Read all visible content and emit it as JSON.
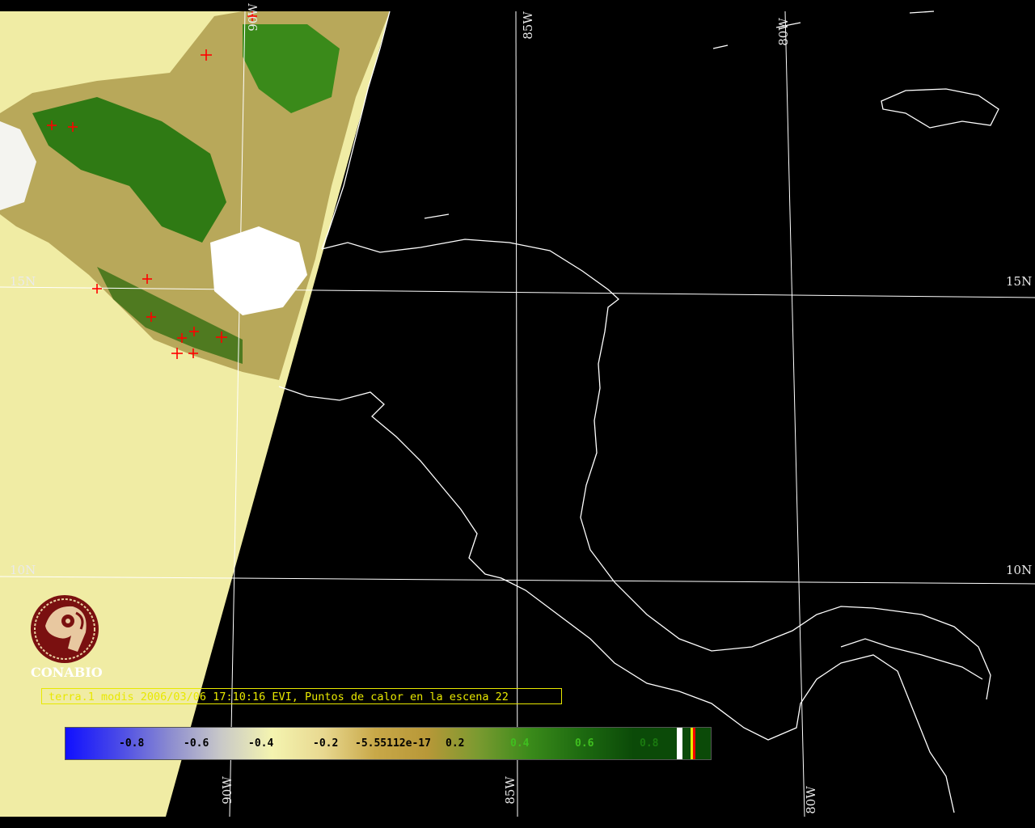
{
  "map": {
    "grid_labels": {
      "lon_85w_top": "85W",
      "lon_80w_top": "80W",
      "lon_90w_top": "90W",
      "lon_90w_bottom": "90W",
      "lon_85w_bottom": "85W",
      "lon_80w_bottom": "80W",
      "lat_15n_left": "15N",
      "lat_15n_right": "15N",
      "lat_10n_left": "10N",
      "lat_10n_right": "10N"
    },
    "colors": {
      "background": "#000000",
      "no_data_swath": "#f0eca4",
      "grid_and_coast": "#ffffff",
      "hotspot": "#ff0000",
      "caption": "#e8e800"
    }
  },
  "logo": {
    "name": "CONABIO",
    "icon": "conabio-macaw-logo"
  },
  "caption": {
    "text": "terra.1 modis 2006/03/06 17:10:16 EVI, Puntos de calor en la escena 22"
  },
  "colorbar": {
    "ticks": [
      "-0.8",
      "-0.6",
      "-0.4",
      "-0.2",
      "-5.55112e-17",
      "0.2",
      "0.4",
      "0.6",
      "0.8"
    ],
    "tick_colors": [
      "#000000",
      "#000000",
      "#000000",
      "#000000",
      "#000000",
      "#000000",
      "#3fbf1f",
      "#3fbf1f",
      "#1a7a0f"
    ]
  }
}
